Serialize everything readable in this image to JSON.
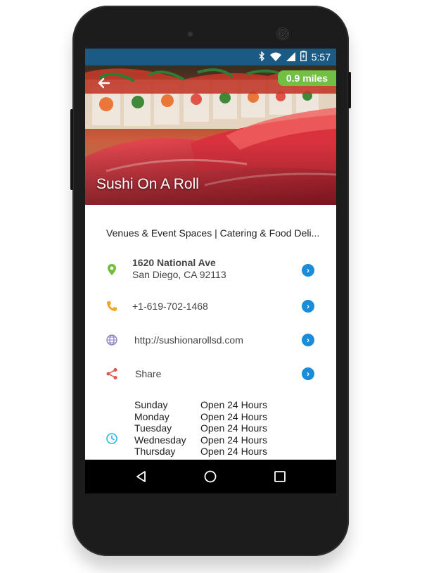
{
  "status_bar": {
    "time": "5:57",
    "icons": [
      "bluetooth-icon",
      "wifi-icon",
      "signal-icon",
      "battery-icon"
    ],
    "bg_color": "#1b5a84"
  },
  "hero": {
    "title": "Sushi On A Roll",
    "distance": "0.9 miles",
    "distance_color": "#72c043",
    "back_icon": "back-arrow-icon"
  },
  "details": {
    "categories": "Venues & Event Spaces | Catering & Food Deli...",
    "address": {
      "line1": "1620 National Ave",
      "line2": "San Diego, CA 92113",
      "icon": "location-pin-icon",
      "icon_color": "#6fbf3a"
    },
    "phone": {
      "value": "+1-619-702-1468",
      "icon": "phone-icon",
      "icon_color": "#f5a623"
    },
    "website": {
      "value": "http://sushionarollsd.com",
      "icon": "globe-icon",
      "icon_color": "#8e7cc3"
    },
    "share": {
      "label": "Share",
      "icon": "share-icon",
      "icon_color": "#e5534b"
    },
    "chevron_color": "#1a8cd8"
  },
  "hours": {
    "icon": "clock-icon",
    "icon_color": "#2bb5e8",
    "rows": [
      {
        "day": "Sunday",
        "time": "Open 24 Hours"
      },
      {
        "day": "Monday",
        "time": "Open 24 Hours"
      },
      {
        "day": "Tuesday",
        "time": "Open 24 Hours"
      },
      {
        "day": "Wednesday",
        "time": "Open 24 Hours"
      },
      {
        "day": "Thursday",
        "time": "Open 24 Hours"
      }
    ]
  },
  "nav_bar": {
    "buttons": [
      "back-triangle-icon",
      "home-circle-icon",
      "recents-square-icon"
    ]
  }
}
